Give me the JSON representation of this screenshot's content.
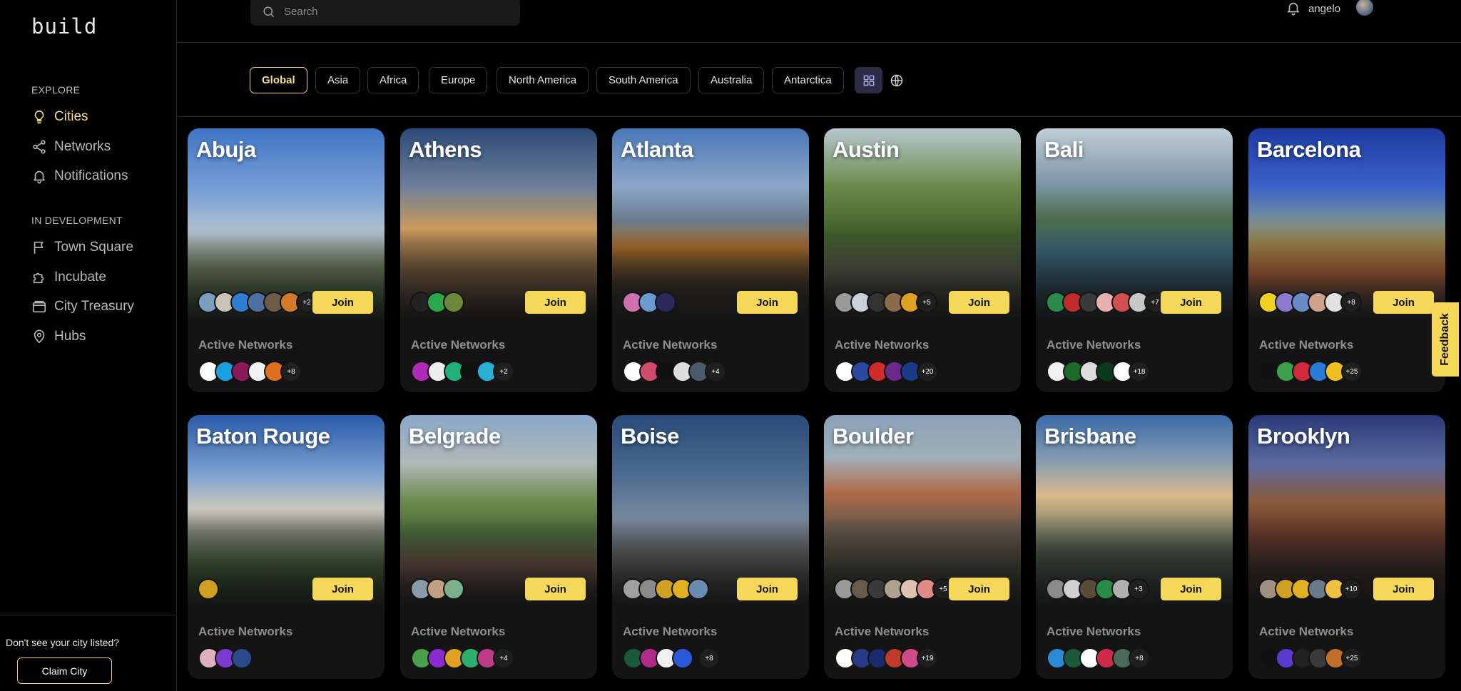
{
  "app": {
    "logo": "build"
  },
  "sidebar": {
    "explore_label": "EXPLORE",
    "explore_items": [
      {
        "label": "Cities",
        "icon": "lightbulb-icon",
        "active": true
      },
      {
        "label": "Networks",
        "icon": "network-icon"
      },
      {
        "label": "Notifications",
        "icon": "bell-icon"
      }
    ],
    "dev_label": "IN DEVELOPMENT",
    "dev_items": [
      {
        "label": "Town Square",
        "icon": "flag-icon"
      },
      {
        "label": "Incubate",
        "icon": "puzzle-icon"
      },
      {
        "label": "City Treasury",
        "icon": "wallet-icon"
      },
      {
        "label": "Hubs",
        "icon": "map-pin-icon"
      }
    ],
    "footer_text": "Don't see your city listed?",
    "claim_label": "Claim City"
  },
  "header": {
    "search_placeholder": "Search",
    "username": "angelo"
  },
  "filters": {
    "regions": [
      "Global",
      "Asia",
      "Africa",
      "Europe",
      "North America",
      "South America",
      "Australia",
      "Antarctica"
    ],
    "active": "Global",
    "views": [
      "grid-view-icon",
      "globe-icon"
    ]
  },
  "cards": {
    "join_label": "Join",
    "active_networks_label": "Active Networks",
    "items": [
      {
        "city": "Abuja",
        "members_more": "+2",
        "networks_more": "+8"
      },
      {
        "city": "Athens",
        "members_more": "",
        "networks_more": "+2"
      },
      {
        "city": "Atlanta",
        "members_more": "",
        "networks_more": "+4"
      },
      {
        "city": "Austin",
        "members_more": "+5",
        "networks_more": "+20"
      },
      {
        "city": "Bali",
        "members_more": "+7",
        "networks_more": "+18"
      },
      {
        "city": "Barcelona",
        "members_more": "+8",
        "networks_more": "+25"
      },
      {
        "city": "Baton Rouge",
        "members_more": "",
        "networks_more": ""
      },
      {
        "city": "Belgrade",
        "members_more": "",
        "networks_more": "+4"
      },
      {
        "city": "Boise",
        "members_more": "",
        "networks_more": "+8"
      },
      {
        "city": "Boulder",
        "members_more": "+5",
        "networks_more": "+19"
      },
      {
        "city": "Brisbane",
        "members_more": "+3",
        "networks_more": "+8"
      },
      {
        "city": "Brooklyn",
        "members_more": "+10",
        "networks_more": "+25"
      }
    ]
  },
  "feedback_label": "Feedback",
  "colors": {
    "accent": "#f5d85a",
    "active_text": "#f5df8e",
    "card_bg": "#141414"
  }
}
